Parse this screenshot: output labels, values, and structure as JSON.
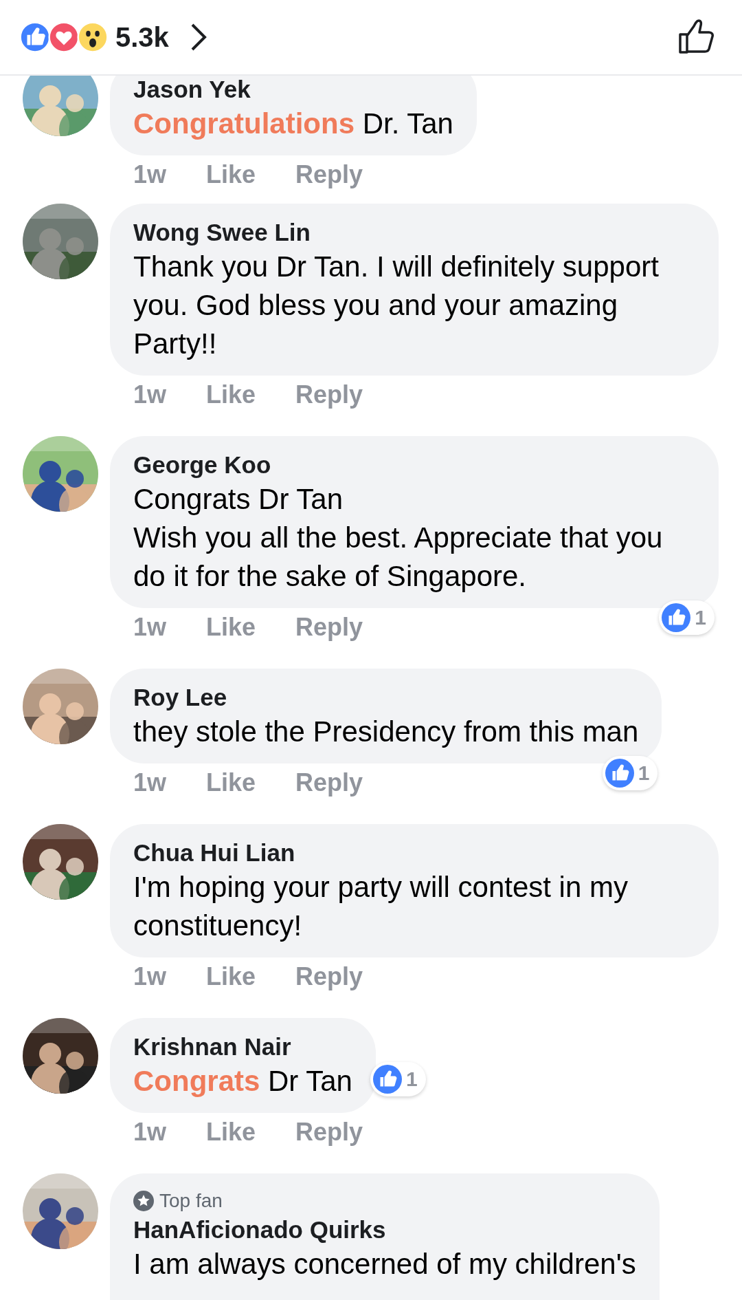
{
  "header": {
    "reaction_count": "5.3k"
  },
  "comments": [
    {
      "name": "Jason Yek",
      "body_highlight": "Congratulations",
      "body": " Dr. Tan",
      "time": "1w",
      "like": "Like",
      "reply": "Reply"
    },
    {
      "name": "Wong Swee Lin",
      "body": "Thank you Dr Tan. I will definitely support you. God bless you and your amazing Party!!",
      "time": "1w",
      "like": "Like",
      "reply": "Reply"
    },
    {
      "name": "George Koo",
      "body": "Congrats Dr Tan\nWish you all the best. Appreciate that you do it for the sake of Singapore.",
      "time": "1w",
      "like": "Like",
      "reply": "Reply",
      "reactions": {
        "count": "1",
        "kind": "below"
      }
    },
    {
      "name": "Roy Lee",
      "body": "they stole the Presidency from this man",
      "time": "1w",
      "like": "Like",
      "reply": "Reply",
      "reactions": {
        "count": "1",
        "kind": "below"
      }
    },
    {
      "name": "Chua Hui Lian",
      "body": "I'm hoping your party will contest in my constituency!",
      "time": "1w",
      "like": "Like",
      "reply": "Reply"
    },
    {
      "name": "Krishnan Nair",
      "body_highlight": "Congrats",
      "body": " Dr Tan",
      "time": "1w",
      "like": "Like",
      "reply": "Reply",
      "reactions": {
        "count": "1",
        "kind": "side"
      }
    },
    {
      "badge": "Top fan",
      "name": "HanAficionado Quirks",
      "body": "I am always concerned of my children's"
    }
  ]
}
